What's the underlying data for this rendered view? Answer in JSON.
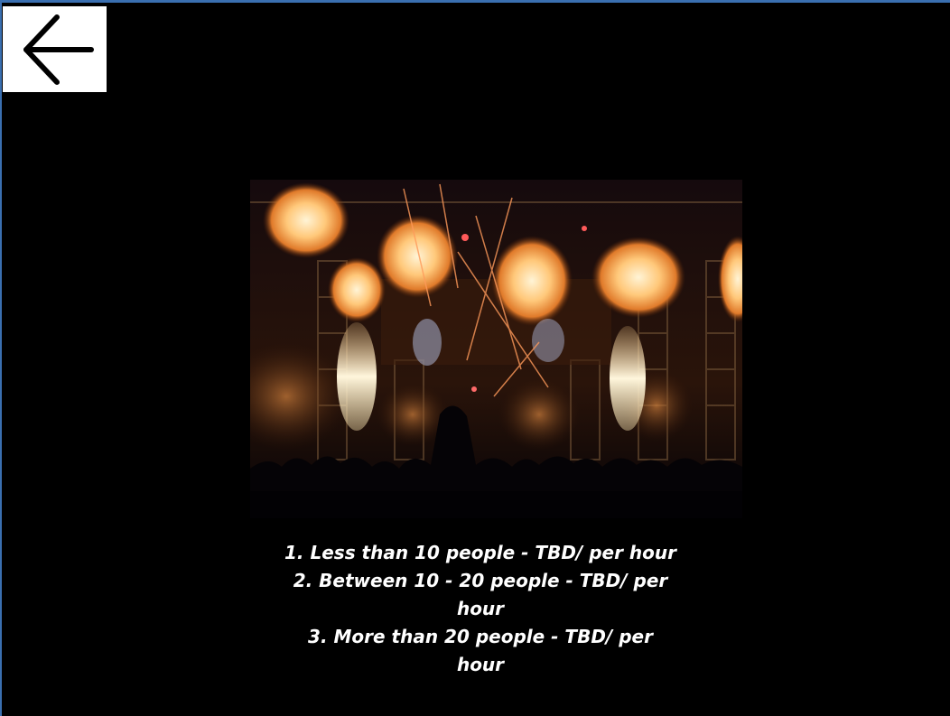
{
  "toolbar": {
    "back_icon": "arrow-left-icon"
  },
  "image": {
    "description_icon": "concert-pyrotechnics-photo"
  },
  "pricing": {
    "items": [
      "1. Less than 10 people - TBD/ per hour",
      "2. Between 10 - 20 people - TBD/ per hour",
      "3. More than 20 people - TBD/ per hour"
    ]
  },
  "colors": {
    "background": "#000000",
    "text": "#ffffff",
    "back_button_bg": "#ffffff",
    "flame": "#f7a64a",
    "flame_core": "#fff1c8",
    "frame_border": "#3a6fb0"
  }
}
